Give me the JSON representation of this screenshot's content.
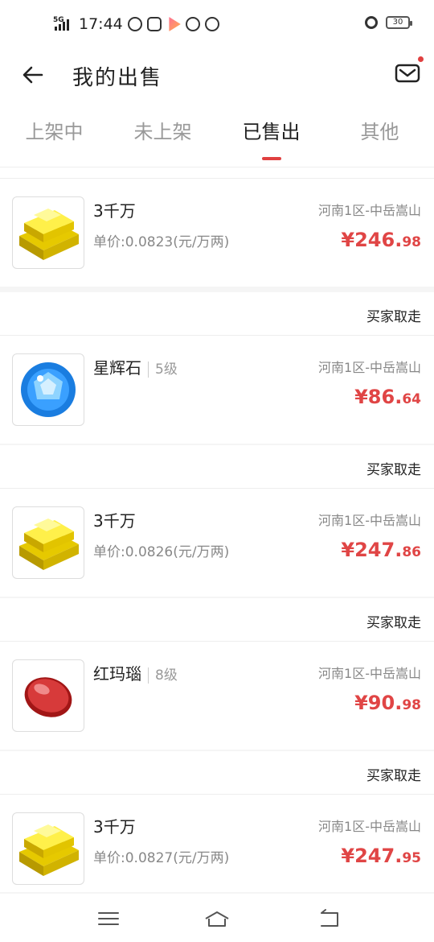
{
  "status_bar": {
    "network": "5G",
    "time": "17:44",
    "battery": "30"
  },
  "header": {
    "title": "我的出售"
  },
  "tabs": [
    {
      "label": "上架中",
      "active": false
    },
    {
      "label": "未上架",
      "active": false
    },
    {
      "label": "已售出",
      "active": true
    },
    {
      "label": "其他",
      "active": false
    }
  ],
  "orders": [
    {
      "status": "",
      "name": "3千万",
      "level": "",
      "unit_price": "单价:0.0823(元/万两)",
      "server": "河南1区-中岳嵩山",
      "price_int": "¥246.",
      "price_dec": "98",
      "icon": "gold-bars-icon"
    },
    {
      "status": "买家取走",
      "name": "星辉石",
      "level": "5级",
      "unit_price": "",
      "server": "河南1区-中岳嵩山",
      "price_int": "¥86.",
      "price_dec": "64",
      "icon": "blue-gem-icon"
    },
    {
      "status": "买家取走",
      "name": "3千万",
      "level": "",
      "unit_price": "单价:0.0826(元/万两)",
      "server": "河南1区-中岳嵩山",
      "price_int": "¥247.",
      "price_dec": "86",
      "icon": "gold-bars-icon"
    },
    {
      "status": "买家取走",
      "name": "红玛瑙",
      "level": "8级",
      "unit_price": "",
      "server": "河南1区-中岳嵩山",
      "price_int": "¥90.",
      "price_dec": "98",
      "icon": "red-agate-icon"
    },
    {
      "status": "买家取走",
      "name": "3千万",
      "level": "",
      "unit_price": "单价:0.0827(元/万两)",
      "server": "河南1区-中岳嵩山",
      "price_int": "¥247.",
      "price_dec": "95",
      "icon": "gold-bars-icon"
    }
  ]
}
